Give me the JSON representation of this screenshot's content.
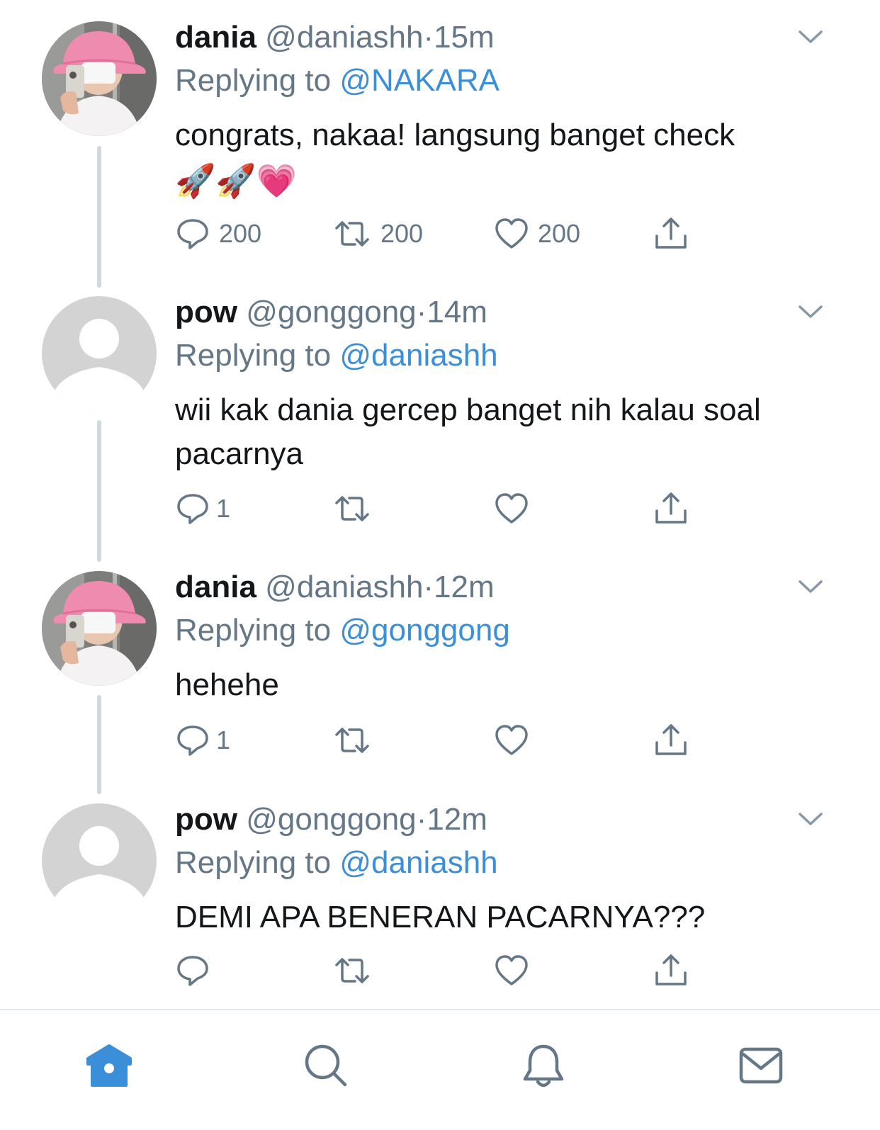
{
  "tweets": [
    {
      "name": "dania",
      "handle": "@daniashh",
      "dot": "·",
      "time": "15m",
      "replying_label": "Replying to",
      "replying_to": "@NAKARA",
      "text": "congrats, nakaa! langsung banget check",
      "emoji": "🚀🚀💗",
      "avatar": "photo-avatar",
      "replies": "200",
      "retweets": "200",
      "likes": "200"
    },
    {
      "name": "pow",
      "handle": "@gonggong",
      "dot": "·",
      "time": "14m",
      "replying_label": "Replying to",
      "replying_to": "@daniashh",
      "text": "wii kak dania gercep banget nih kalau soal pacarnya",
      "avatar": "default-avatar",
      "replies": "1",
      "retweets": "",
      "likes": ""
    },
    {
      "name": "dania",
      "handle": "@daniashh",
      "dot": "·",
      "time": "12m",
      "replying_label": "Replying to",
      "replying_to": "@gonggong",
      "text": "hehehe",
      "avatar": "photo-avatar",
      "replies": "1",
      "retweets": "",
      "likes": ""
    },
    {
      "name": "pow",
      "handle": "@gonggong",
      "dot": "·",
      "time": "12m",
      "replying_label": "Replying to",
      "replying_to": "@daniashh",
      "text": "DEMI APA BENERAN PACARNYA???",
      "avatar": "default-avatar",
      "replies": "",
      "retweets": "",
      "likes": ""
    }
  ],
  "colors": {
    "link": "#3b8fd9",
    "muted": "#657786",
    "thread_line": "#cfd9de",
    "tab_active": "#3b8fd9",
    "tab_inactive": "#657786"
  },
  "tabbar": {
    "items": [
      "home-icon",
      "search-icon",
      "bell-icon",
      "mail-icon"
    ],
    "active": "home-icon"
  }
}
